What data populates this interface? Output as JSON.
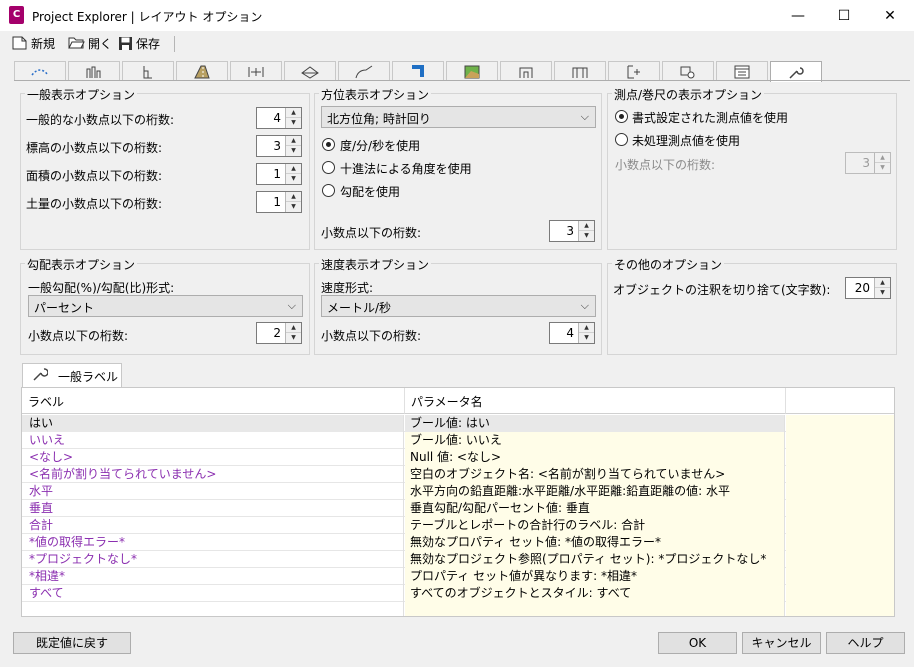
{
  "window": {
    "title": "Project Explorer | レイアウト オプション",
    "app_icon_letter": "C",
    "minimize": "—",
    "maximize": "☐",
    "close": "✕"
  },
  "toolbar": {
    "new_label": "新規",
    "open_label": "開く",
    "save_label": "保存"
  },
  "tabs": [
    "alignment-icon",
    "profile-icon",
    "profile-view-icon",
    "corridor-icon",
    "assembly-icon",
    "surface-icon",
    "pipe-network-icon",
    "pressure-network-icon",
    "point-icon",
    "parcel-icon",
    "structure-icon",
    "grading-icon",
    "sample-line-icon",
    "table-icon",
    "wrench-icon"
  ],
  "general_display": {
    "title": "一般表示オプション",
    "rows": [
      {
        "label": "一般的な小数点以下の桁数:",
        "value": "4"
      },
      {
        "label": "標高の小数点以下の桁数:",
        "value": "3"
      },
      {
        "label": "面積の小数点以下の桁数:",
        "value": "1"
      },
      {
        "label": "土量の小数点以下の桁数:",
        "value": "1"
      }
    ]
  },
  "bearing_display": {
    "title": "方位表示オプション",
    "dropdown_value": "北方位角; 時計回り",
    "radios": [
      {
        "label": "度/分/秒を使用",
        "selected": true
      },
      {
        "label": "十進法による角度を使用",
        "selected": false
      },
      {
        "label": "勾配を使用",
        "selected": false
      }
    ],
    "decimals_label": "小数点以下の桁数:",
    "decimals_value": "3"
  },
  "station_display": {
    "title": "測点/巻尺の表示オプション",
    "radios": [
      {
        "label": "書式設定された測点値を使用",
        "selected": true
      },
      {
        "label": "未処理測点値を使用",
        "selected": false
      }
    ],
    "decimals_label": "小数点以下の桁数:",
    "decimals_value": "3"
  },
  "grade_display": {
    "title": "勾配表示オプション",
    "format_label": "一般勾配(%)/勾配(比)形式:",
    "format_value": "パーセント",
    "decimals_label": "小数点以下の桁数:",
    "decimals_value": "2"
  },
  "speed_display": {
    "title": "速度表示オプション",
    "format_label": "速度形式:",
    "format_value": "メートル/秒",
    "decimals_label": "小数点以下の桁数:",
    "decimals_value": "4"
  },
  "other_options": {
    "title": "その他のオプション",
    "truncate_label": "オブジェクトの注釈を切り捨て(文字数):",
    "truncate_value": "20"
  },
  "general_labels": {
    "tab_label": "一般ラベル",
    "columns": [
      "ラベル",
      "パラメータ名"
    ],
    "rows": [
      {
        "label": "はい",
        "param": "ブール値: はい"
      },
      {
        "label": "いいえ",
        "param": "ブール値: いいえ"
      },
      {
        "label": "<なし>",
        "param": "Null 値: <なし>"
      },
      {
        "label": "<名前が割り当てられていません>",
        "param": "空白のオブジェクト名: <名前が割り当てられていません>"
      },
      {
        "label": "水平",
        "param": "水平方向の鉛直距離:水平距離/水平距離:鉛直距離の値: 水平"
      },
      {
        "label": "垂直",
        "param": "垂直勾配/勾配パーセント値: 垂直"
      },
      {
        "label": "合計",
        "param": "テーブルとレポートの合計行のラベル: 合計"
      },
      {
        "label": "*値の取得エラー*",
        "param": "無効なプロパティ セット値: *値の取得エラー*"
      },
      {
        "label": "*プロジェクトなし*",
        "param": "無効なプロジェクト参照(プロパティ セット): *プロジェクトなし*"
      },
      {
        "label": "*相違*",
        "param": "プロパティ セット値が異なります: *相違*"
      },
      {
        "label": "すべて",
        "param": "すべてのオブジェクトとスタイル: すべて"
      }
    ]
  },
  "footer": {
    "reset_label": "既定値に戻す",
    "ok_label": "OK",
    "cancel_label": "キャンセル",
    "help_label": "ヘルプ"
  }
}
